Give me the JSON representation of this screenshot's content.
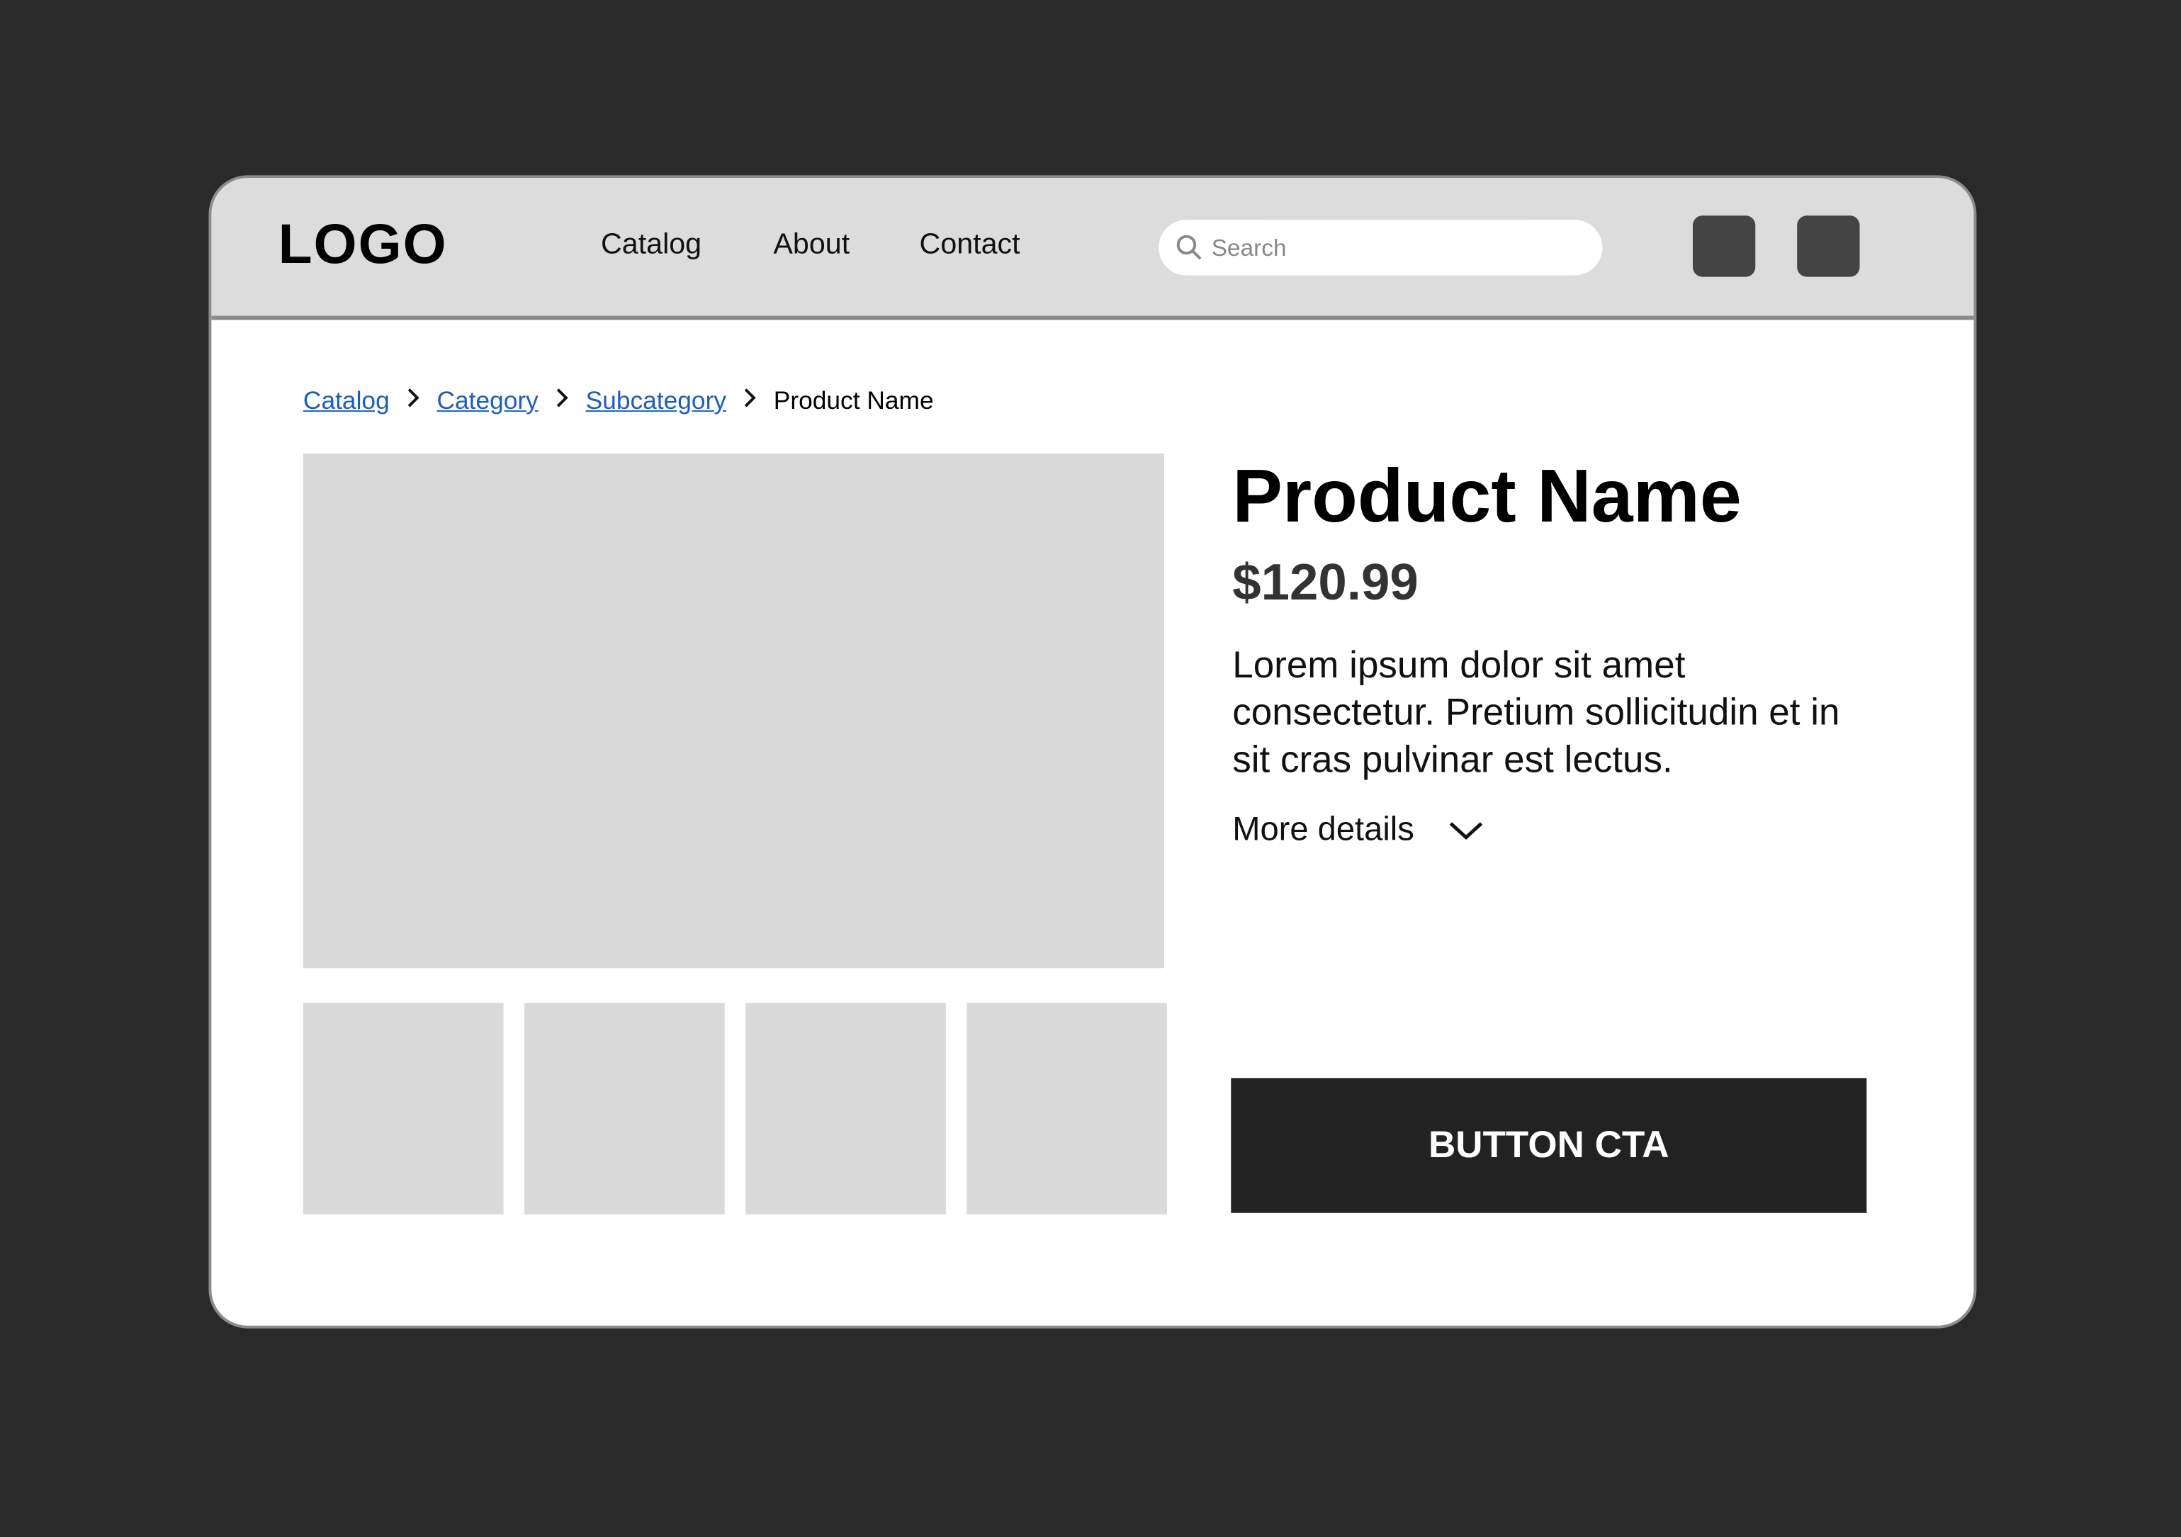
{
  "header": {
    "logo": "LOGO",
    "nav": [
      "Catalog",
      "About",
      "Contact"
    ],
    "search_placeholder": "Search",
    "icon_buttons": [
      "icon-button-1",
      "icon-button-2"
    ]
  },
  "breadcrumb": {
    "links": [
      "Catalog",
      "Category",
      "Subcategory"
    ],
    "current": "Product Name"
  },
  "product": {
    "title": "Product Name",
    "price": "$120.99",
    "description": "Lorem ipsum dolor sit amet consectetur. Pretium sollicitudin et in sit cras pulvinar est lectus.",
    "more_details": "More details",
    "cta": "BUTTON CTA"
  },
  "colors": {
    "background": "#2a2a2a",
    "header": "#dcdcdc",
    "link": "#1a5fc0",
    "placeholder": "#dadada",
    "cta": "#222222"
  }
}
